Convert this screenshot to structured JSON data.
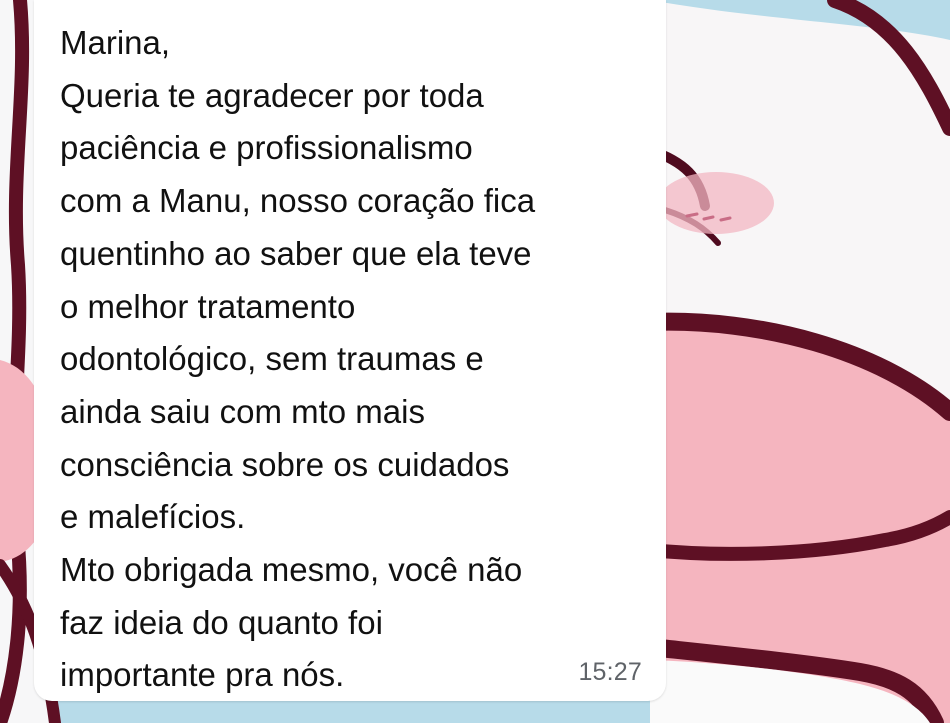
{
  "chat": {
    "message": {
      "lines": [
        "Marina,",
        "Queria te agradecer por toda",
        "paciência e profissionalismo",
        "com a Manu, nosso coração fica",
        "quentinho ao saber que ela teve",
        "o melhor tratamento",
        "odontológico, sem traumas e",
        "ainda saiu com mto mais",
        "consciência sobre os cuidados",
        "e malefícios.",
        "Mto obrigada mesmo, você não",
        "faz ideia do quanto foi",
        "importante pra nós."
      ],
      "time": "15:27"
    }
  },
  "colors": {
    "wallpaper_blue": "#b7dbe9",
    "character_pink": "#f5b5bf",
    "character_outline": "#6f0b2c",
    "bubble_white": "#ffffff"
  },
  "background": {
    "illustration": "pink-cartoon-character"
  }
}
